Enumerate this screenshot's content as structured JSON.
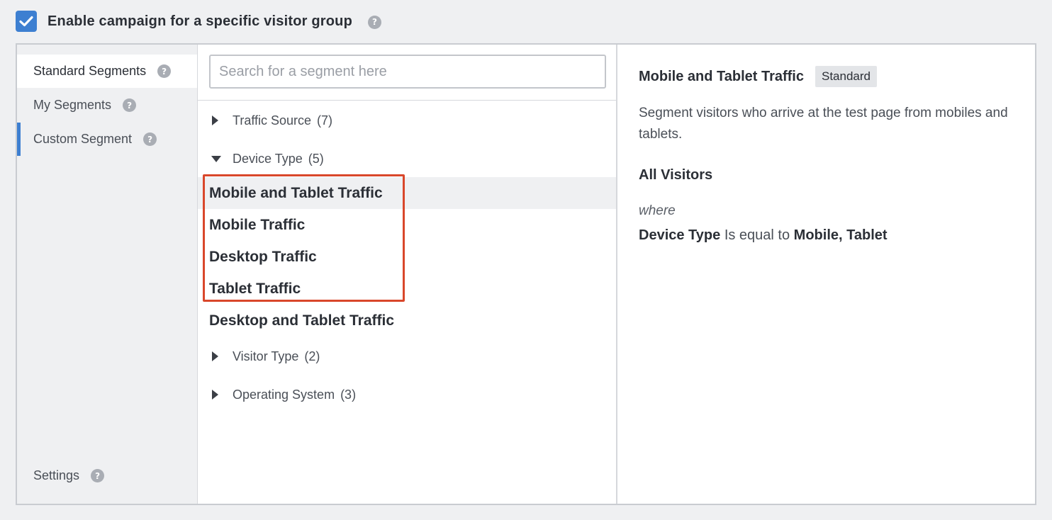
{
  "header": {
    "enable_label": "Enable campaign for a specific visitor group",
    "enable_checked": true,
    "help_glyph": "?"
  },
  "sidebar": {
    "items": [
      {
        "label": "Standard Segments",
        "help": "?"
      },
      {
        "label": "My Segments",
        "help": "?"
      },
      {
        "label": "Custom Segment",
        "help": "?"
      },
      {
        "label": "Settings",
        "help": "?"
      }
    ]
  },
  "search": {
    "placeholder": "Search for a segment here",
    "value": ""
  },
  "categories": [
    {
      "label": "Traffic Source",
      "count": "(7)",
      "expanded": false
    },
    {
      "label": "Device Type",
      "count": "(5)",
      "expanded": true
    },
    {
      "label": "Visitor Type",
      "count": "(2)",
      "expanded": false
    },
    {
      "label": "Operating System",
      "count": "(3)",
      "expanded": false
    }
  ],
  "device_segments": [
    {
      "label": "Mobile and Tablet Traffic",
      "selected": true
    },
    {
      "label": "Mobile Traffic",
      "selected": false
    },
    {
      "label": "Desktop Traffic",
      "selected": false
    },
    {
      "label": "Tablet Traffic",
      "selected": false
    },
    {
      "label": "Desktop and Tablet Traffic",
      "selected": false
    }
  ],
  "detail": {
    "title": "Mobile and Tablet Traffic",
    "badge": "Standard",
    "description": "Segment visitors who arrive at the test page from mobiles and tablets.",
    "audience": "All Visitors",
    "where": "where",
    "rule_field": "Device Type",
    "rule_operator": "Is equal to",
    "rule_value": "Mobile, Tablet"
  },
  "colors": {
    "accent": "#3d7fd1",
    "highlight_box": "#d9472b",
    "background": "#eff0f2"
  }
}
